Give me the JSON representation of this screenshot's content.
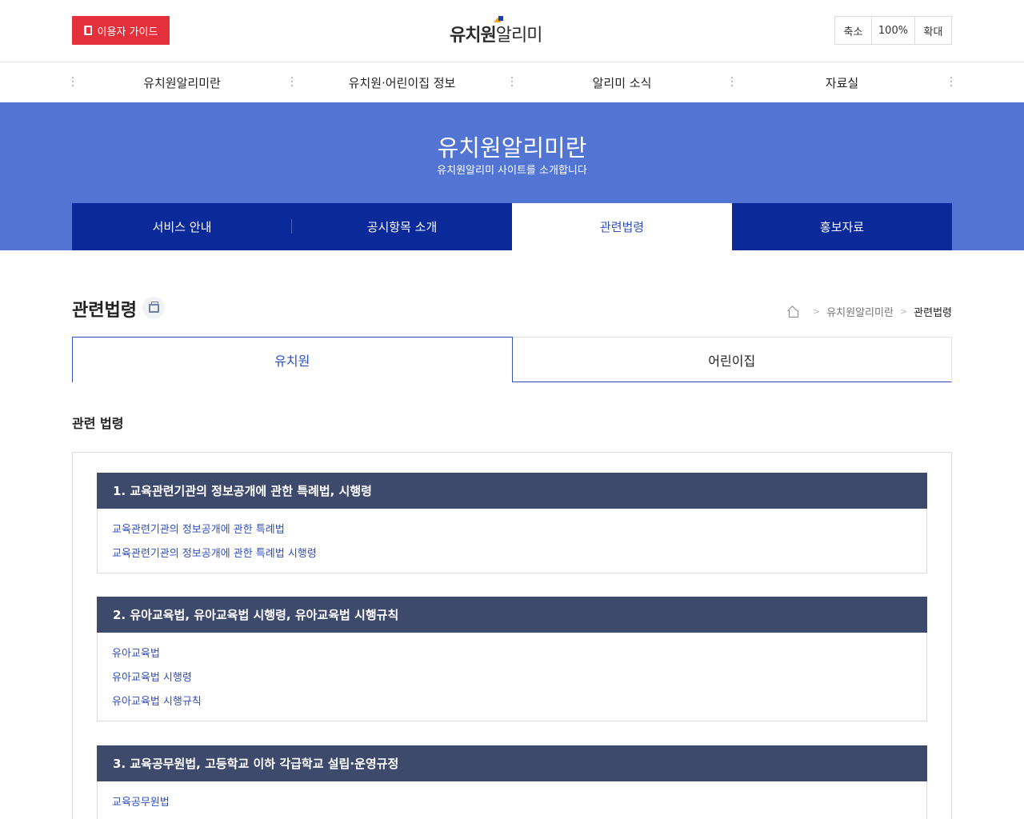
{
  "header": {
    "guide_button": "이용자 가이드",
    "logo_bold": "유치원",
    "logo_light": "알리미",
    "zoom": {
      "out": "축소",
      "level": "100%",
      "in": "확대"
    }
  },
  "gnb": [
    {
      "label": "유치원알리미란"
    },
    {
      "label": "유치원·어린이집 정보"
    },
    {
      "label": "알리미 소식"
    },
    {
      "label": "자료실"
    }
  ],
  "visual": {
    "title": "유치원알리미란",
    "subtitle": "유치원알리미 사이트를 소개합니다"
  },
  "subnav": [
    {
      "label": "서비스 안내"
    },
    {
      "label": "공시항목 소개"
    },
    {
      "label": "관련법령"
    },
    {
      "label": "홍보자료"
    }
  ],
  "page": {
    "title": "관련법령",
    "breadcrumb": {
      "parent": "유치원알리미란",
      "current": "관련법령"
    }
  },
  "tabs": [
    {
      "label": "유치원"
    },
    {
      "label": "어린이집"
    }
  ],
  "section_title": "관련 법령",
  "law_groups": [
    {
      "title": "1. 교육관련기관의 정보공개에 관한 특례법, 시행령",
      "links": [
        "교육관련기관의 정보공개에 관한 특례법",
        "교육관련기관의 정보공개에 관한 특례법 시행령"
      ]
    },
    {
      "title": "2. 유아교육법, 유아교육법 시행령, 유아교육법 시행규칙",
      "links": [
        "유아교육법",
        "유아교육법 시행령",
        "유아교육법 시행규칙"
      ]
    },
    {
      "title": "3. 교육공무원법, 고등학교 이하 각급학교 설립·운영규정",
      "links": [
        "교육공무원법"
      ]
    }
  ],
  "colors": {
    "banner": "#5275d4",
    "subnav": "#0a2a9a",
    "guide_button": "#e3303b",
    "law_header": "#3d4a6b",
    "link": "#2e4fc4"
  }
}
